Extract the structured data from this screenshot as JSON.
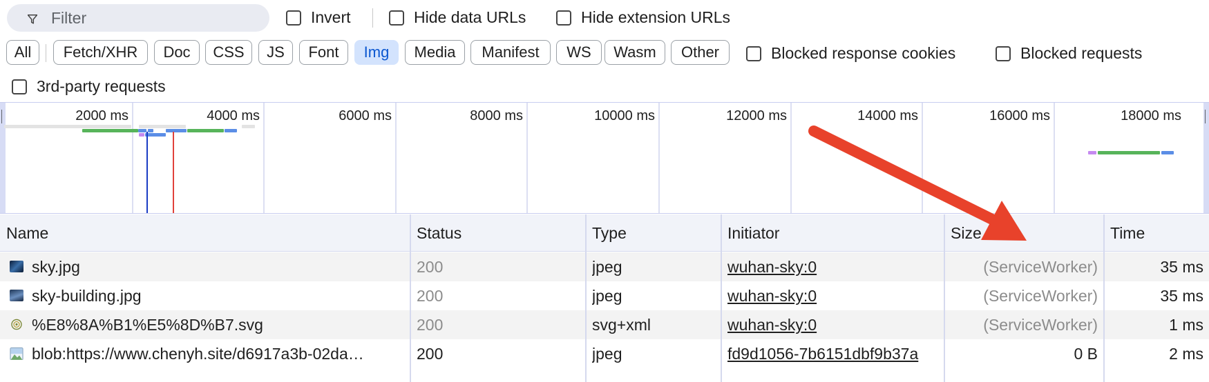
{
  "filter_bar": {
    "filter_placeholder": "Filter",
    "invert_label": "Invert",
    "hide_data_urls_label": "Hide data URLs",
    "hide_extension_urls_label": "Hide extension URLs"
  },
  "type_filters": [
    {
      "label": "All",
      "active": false
    },
    {
      "label": "Fetch/XHR",
      "active": false
    },
    {
      "label": "Doc",
      "active": false
    },
    {
      "label": "CSS",
      "active": false
    },
    {
      "label": "JS",
      "active": false
    },
    {
      "label": "Font",
      "active": false
    },
    {
      "label": "Img",
      "active": true
    },
    {
      "label": "Media",
      "active": false
    },
    {
      "label": "Manifest",
      "active": false
    },
    {
      "label": "WS",
      "active": false
    },
    {
      "label": "Wasm",
      "active": false
    },
    {
      "label": "Other",
      "active": false
    }
  ],
  "extra_filters": {
    "blocked_response_cookies_label": "Blocked response cookies",
    "blocked_requests_label": "Blocked requests",
    "third_party_label": "3rd-party requests"
  },
  "overview": {
    "ticks": [
      "2000 ms",
      "4000 ms",
      "6000 ms",
      "8000 ms",
      "10000 ms",
      "12000 ms",
      "14000 ms",
      "16000 ms",
      "18000 ms"
    ],
    "colors": {
      "waiting": "#57b45a",
      "download": "#5b8ee6",
      "queue": "#c58af0",
      "idle": "#e3e3e3",
      "dom_content_loaded": "#1a3cc4",
      "load": "#e0413a"
    }
  },
  "table": {
    "headers": {
      "name": "Name",
      "status": "Status",
      "type": "Type",
      "initiator": "Initiator",
      "size": "Size",
      "time": "Time"
    },
    "rows": [
      {
        "icon": "image-thumbnail-icon",
        "name": "sky.jpg",
        "status": "200",
        "type": "jpeg",
        "initiator": "wuhan-sky:0",
        "size": "(ServiceWorker)",
        "time": "35 ms"
      },
      {
        "icon": "image-thumbnail-icon",
        "name": "sky-building.jpg",
        "status": "200",
        "type": "jpeg",
        "initiator": "wuhan-sky:0",
        "size": "(ServiceWorker)",
        "time": "35 ms"
      },
      {
        "icon": "svg-thumbnail-icon",
        "name": "%E8%8A%B1%E5%8D%B7.svg",
        "status": "200",
        "type": "svg+xml",
        "initiator": "wuhan-sky:0",
        "size": "(ServiceWorker)",
        "time": "1 ms"
      },
      {
        "icon": "blob-image-icon",
        "name": "blob:https://www.chenyh.site/d6917a3b-02da…",
        "status": "200",
        "type": "jpeg",
        "initiator": "fd9d1056-7b6151dbf9b37a",
        "size": "0 B",
        "time": "2 ms"
      }
    ]
  },
  "annotation": {
    "arrow_color": "#e8422b"
  }
}
